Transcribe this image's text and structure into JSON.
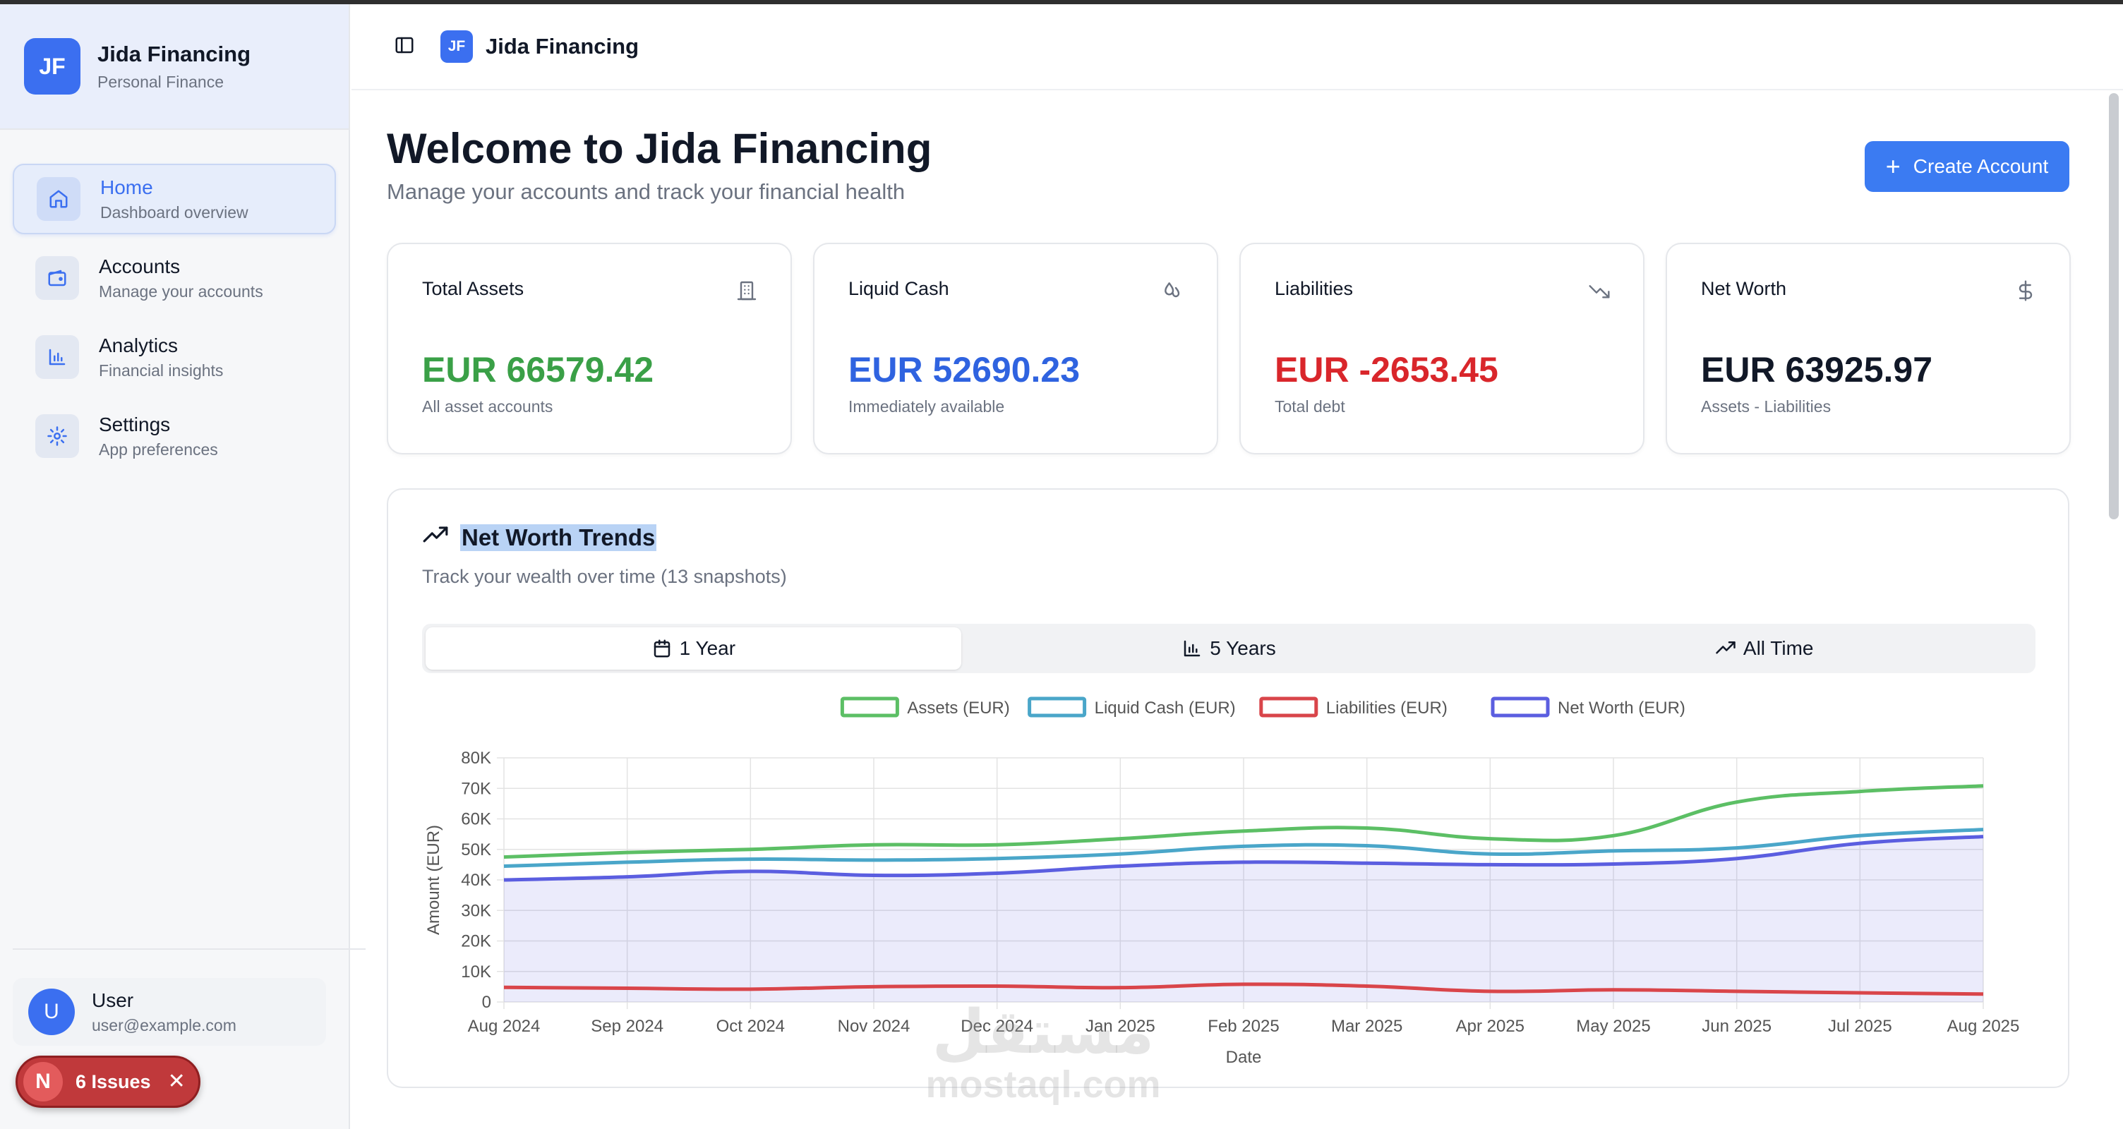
{
  "brand": {
    "logo": "JF",
    "title": "Jida Financing",
    "subtitle": "Personal Finance"
  },
  "sidebar": {
    "items": [
      {
        "label": "Home",
        "sub": "Dashboard overview",
        "icon": "home-icon",
        "active": true
      },
      {
        "label": "Accounts",
        "sub": "Manage your accounts",
        "icon": "wallet-icon"
      },
      {
        "label": "Analytics",
        "sub": "Financial insights",
        "icon": "bar-chart-icon"
      },
      {
        "label": "Settings",
        "sub": "App preferences",
        "icon": "gear-icon"
      }
    ]
  },
  "user": {
    "initial": "U",
    "name": "User",
    "email": "user@example.com"
  },
  "issues": {
    "badge": "N",
    "label": "6 Issues"
  },
  "topbar": {
    "logo": "JF",
    "app_name": "Jida Financing"
  },
  "header": {
    "title": "Welcome to Jida Financing",
    "subtitle": "Manage your accounts and track your financial health",
    "create_button": "Create Account"
  },
  "cards": [
    {
      "title": "Total Assets",
      "value": "EUR 66579.42",
      "note": "All asset accounts",
      "color": "#3aa047",
      "icon": "building-icon"
    },
    {
      "title": "Liquid Cash",
      "value": "EUR 52690.23",
      "note": "Immediately available",
      "color": "#2f63e0",
      "icon": "droplets-icon"
    },
    {
      "title": "Liabilities",
      "value": "EUR -2653.45",
      "note": "Total debt",
      "color": "#d9262b",
      "icon": "trending-down-icon"
    },
    {
      "title": "Net Worth",
      "value": "EUR 63925.97",
      "note": "Assets - Liabilities",
      "color": "#111827",
      "icon": "dollar-icon"
    }
  ],
  "trends": {
    "title": "Net Worth Trends",
    "subtitle": "Track your wealth over time (13 snapshots)",
    "tabs": [
      {
        "label": "1 Year",
        "icon": "calendar-icon",
        "active": true
      },
      {
        "label": "5 Years",
        "icon": "bar-chart-icon"
      },
      {
        "label": "All Time",
        "icon": "trending-up-icon"
      }
    ]
  },
  "watermark": {
    "arabic": "مستقل",
    "latin": "mostaql.com"
  },
  "chart_data": {
    "type": "line",
    "title": "",
    "xlabel": "Date",
    "ylabel": "Amount (EUR)",
    "ylim": [
      0,
      80000
    ],
    "yticks": [
      0,
      10000,
      20000,
      30000,
      40000,
      50000,
      60000,
      70000,
      80000
    ],
    "ytick_labels": [
      "0",
      "10K",
      "20K",
      "30K",
      "40K",
      "50K",
      "60K",
      "70K",
      "80K"
    ],
    "x": [
      "Aug 2024",
      "Sep 2024",
      "Oct 2024",
      "Nov 2024",
      "Dec 2024",
      "Jan 2025",
      "Feb 2025",
      "Mar 2025",
      "Apr 2025",
      "May 2025",
      "Jun 2025",
      "Jul 2025",
      "Aug 2025"
    ],
    "grid": true,
    "legend": "top",
    "series": [
      {
        "name": "Assets (EUR)",
        "color": "#5cbf65",
        "values": [
          47500,
          49000,
          50000,
          51500,
          51500,
          53500,
          56000,
          57000,
          53500,
          54500,
          65500,
          69000,
          70800
        ]
      },
      {
        "name": "Liquid Cash (EUR)",
        "color": "#4aa6c9",
        "values": [
          44500,
          45800,
          46800,
          46500,
          47000,
          48500,
          51000,
          51200,
          48500,
          49500,
          50500,
          54500,
          56500
        ]
      },
      {
        "name": "Liabilities (EUR)",
        "color": "#d9454a",
        "values": [
          4800,
          4500,
          4200,
          5000,
          5200,
          4700,
          5800,
          5200,
          3500,
          4000,
          3500,
          3000,
          2600
        ]
      },
      {
        "name": "Net Worth (EUR)",
        "color": "#5b5ee0",
        "fill": "rgba(91,94,224,0.12)",
        "values": [
          40000,
          41000,
          42800,
          41500,
          42200,
          44500,
          45800,
          45500,
          45000,
          45200,
          47000,
          52000,
          54200
        ]
      }
    ]
  }
}
